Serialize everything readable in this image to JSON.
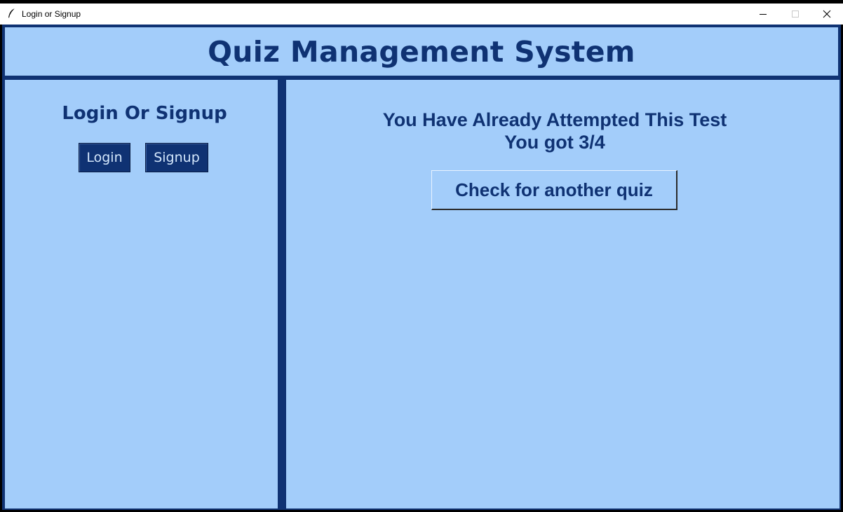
{
  "window": {
    "title": "Login or Signup",
    "icon": "feather-icon",
    "controls": [
      "minimize-icon",
      "maximize-icon",
      "close-icon"
    ]
  },
  "header": {
    "title": "Quiz Management System"
  },
  "sidebar": {
    "heading": "Login Or Signup",
    "login_label": "Login",
    "signup_label": "Signup"
  },
  "main": {
    "message_line1": "You Have Already Attempted This Test",
    "message_line2": "You got 3/4",
    "check_button_label": "Check for another quiz"
  },
  "colors": {
    "primary_dark": "#0f3273",
    "panel_bg": "#a3cdfa",
    "button_text_light": "#d4e7fc",
    "titlebar_bg": "#ffffff"
  }
}
